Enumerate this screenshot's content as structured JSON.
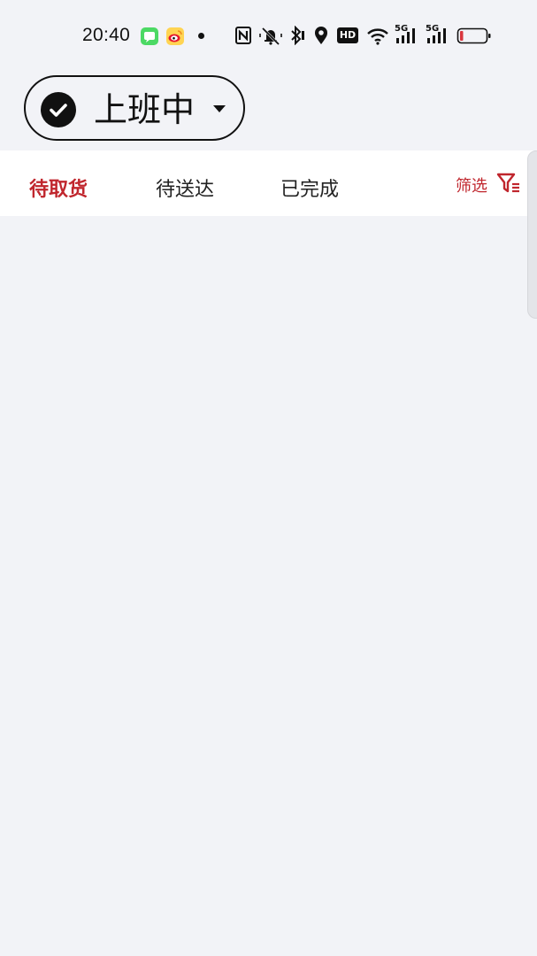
{
  "status_bar": {
    "time": "20:40",
    "icons": [
      "messages-icon",
      "weibo-icon",
      "dot-icon",
      "nfc-icon",
      "mute-icon",
      "bluetooth-icon",
      "location-icon",
      "hd-icon",
      "wifi-icon",
      "5g-signal-icon",
      "5g-signal-icon",
      "battery-icon"
    ],
    "hd_text": "HD",
    "network_1": "5G",
    "network_2": "5G",
    "battery_color": "#d9363e"
  },
  "duty": {
    "label": "上班中",
    "icon": "check-circle-icon"
  },
  "tabs": [
    {
      "label": "待取货",
      "active": true
    },
    {
      "label": "待送达",
      "active": false
    },
    {
      "label": "已完成",
      "active": false
    }
  ],
  "filter": {
    "label": "筛选",
    "icon": "filter-icon"
  },
  "colors": {
    "accent": "#c0262d",
    "background": "#f2f3f7"
  }
}
